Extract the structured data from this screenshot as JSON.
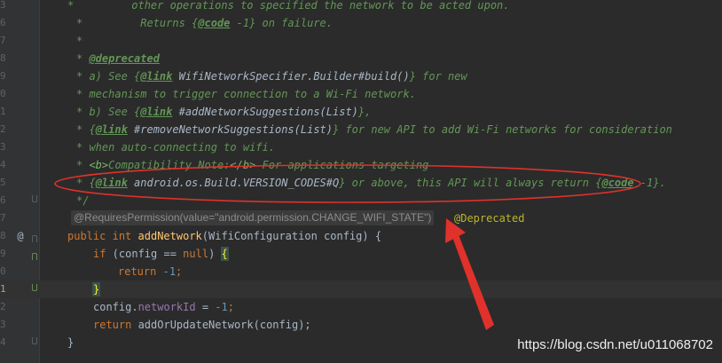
{
  "editor": {
    "line_numbers": [
      "3",
      "6",
      "7",
      "8",
      "9",
      "0",
      "1",
      "2",
      "3",
      "4",
      "5",
      "6",
      "7",
      "8",
      "9",
      "0",
      "1",
      "2",
      "3",
      "4",
      "5",
      "6"
    ],
    "doc_lines": {
      "l0_a": "*",
      "l0_b": "         other operations to specified the network to be acted upon.",
      "l1_a": "*",
      "l1_b": "         Returns {",
      "l1_tag": "@code",
      "l1_c": " -1} on failure.",
      "l2": "*",
      "l3_a": "* ",
      "l3_tag": "@deprecated",
      "l4_a": "* a) See {",
      "l4_tag": "@link",
      "l4_b": " WifiNetworkSpecifier.Builder#build()",
      "l4_c": "} for new",
      "l5": "* mechanism to trigger connection to a Wi-Fi network.",
      "l6_a": "* b) See {",
      "l6_tag": "@link",
      "l6_b": " #addNetworkSuggestions(List)",
      "l6_c": "},",
      "l7_a": "* {",
      "l7_tag": "@link",
      "l7_b": " #removeNetworkSuggestions(List)",
      "l7_c": "} for new API to add Wi-Fi networks for consideration",
      "l8": "* when auto-connecting to wifi.",
      "l9_a": "* ",
      "l9_b": "<b>",
      "l9_c": "Compatibility Note:",
      "l9_d": "</b>",
      "l9_e": " For applications targeting",
      "l10_a": "* {",
      "l10_tag": "@link",
      "l10_b": " android.os.Build.VERSION_CODES#Q",
      "l10_c": "} or above, this API will always return {",
      "l10_tag2": "@code",
      "l10_d": " -1}.",
      "l11": "*/"
    },
    "inlay_hint": "@RequiresPermission(value=\"android.permission.CHANGE_WIFI_STATE\")",
    "deprecated_annotation": "@Deprecated",
    "gutter_marker": "@",
    "code": {
      "sig_kw1": "public",
      "sig_kw2": "int",
      "sig_fn": "addNetwork",
      "sig_rest": "(WifiConfiguration config) {",
      "if_kw": "if",
      "if_a": " (config == ",
      "if_null": "null",
      "if_b": ") ",
      "if_brace": "{",
      "ret_kw": "return",
      "ret_num": "-1",
      "ret_end": ";",
      "close_brace": "}",
      "assign_a": "config.",
      "assign_field": "networkId",
      "assign_b": " = ",
      "assign_num": "-1",
      "assign_end": ";",
      "ret2_kw": "return",
      "ret2_rest": " addOrUpdateNetwork(config);",
      "method_close": "}"
    }
  },
  "colors": {
    "annotation_red": "#e0312b"
  },
  "watermark": "https://blog.csdn.net/u011068702"
}
